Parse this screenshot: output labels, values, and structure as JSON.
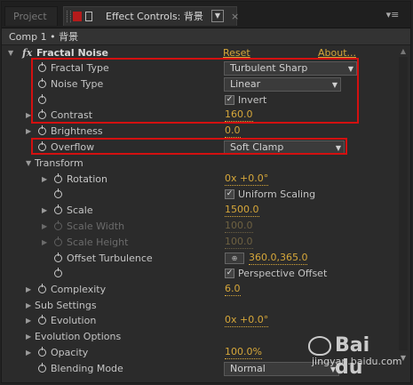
{
  "tabs": {
    "project_label": "Project",
    "effects_label": "Effect Controls: 背景",
    "menu_arrow": "▼",
    "close": "×",
    "panel_menu": "▾≡"
  },
  "breadcrumb": "Comp 1 • 背景",
  "effect": {
    "fx_badge": "fx",
    "name": "Fractal Noise",
    "reset": "Reset",
    "about": "About..."
  },
  "rows": {
    "fractal_type": {
      "label": "Fractal Type",
      "value": "Turbulent Sharp"
    },
    "noise_type": {
      "label": "Noise Type",
      "value": "Linear"
    },
    "invert": {
      "label": "Invert",
      "checked": "✓"
    },
    "contrast": {
      "label": "Contrast",
      "value": "160.0"
    },
    "brightness": {
      "label": "Brightness",
      "value": "0.0"
    },
    "overflow": {
      "label": "Overflow",
      "value": "Soft Clamp"
    },
    "transform": {
      "label": "Transform"
    },
    "rotation": {
      "label": "Rotation",
      "value": "0x +0.0°"
    },
    "uniform_scaling": {
      "label": "Uniform Scaling",
      "checked": "✓"
    },
    "scale": {
      "label": "Scale",
      "value": "1500.0"
    },
    "scale_width": {
      "label": "Scale Width",
      "value": "100.0"
    },
    "scale_height": {
      "label": "Scale Height",
      "value": "100.0"
    },
    "offset_turbulence": {
      "label": "Offset Turbulence",
      "value": "360.0,365.0"
    },
    "perspective_offset": {
      "label": "Perspective Offset",
      "checked": "✓"
    },
    "complexity": {
      "label": "Complexity",
      "value": "6.0"
    },
    "sub_settings": {
      "label": "Sub Settings"
    },
    "evolution": {
      "label": "Evolution",
      "value": "0x +0.0°"
    },
    "evolution_options": {
      "label": "Evolution Options"
    },
    "opacity": {
      "label": "Opacity",
      "value": "100.0%"
    },
    "blending_mode": {
      "label": "Blending Mode",
      "value": "Normal"
    }
  },
  "icons": {
    "expanded": "▼",
    "collapsed": "▶",
    "dropdown_arrow": "▼",
    "crosshair": "⊕"
  },
  "watermark": {
    "line1": "Bai du",
    "line2": "jingyan.baidu.com"
  },
  "colors": {
    "value": "#d6a73a",
    "highlight": "#d31010",
    "panel": "#2b2b2b"
  }
}
